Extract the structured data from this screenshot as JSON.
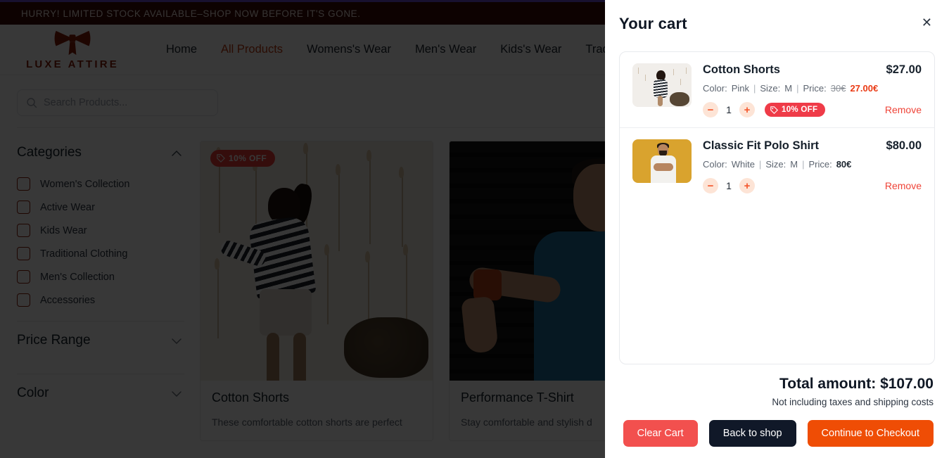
{
  "accent": {
    "promo_bg": "#3b0d05",
    "brand": "#8a1c08",
    "nav_active": "#c0390e",
    "discount_red": "#ef3b48",
    "checkout_orange": "#ef4d05",
    "dark_navy": "#101828",
    "clear_red": "#f2504e",
    "top_rule": "#6c4fd6"
  },
  "promo": {
    "text": "HURRY! LIMITED STOCK AVAILABLE–SHOP NOW BEFORE IT'S GONE."
  },
  "brand": {
    "name": "LUXE ATTIRE",
    "logo_icon": "bow-icon"
  },
  "nav": {
    "items": [
      {
        "label": "Home",
        "active": false
      },
      {
        "label": "All Products",
        "active": true
      },
      {
        "label": "Womens's Wear",
        "active": false
      },
      {
        "label": "Men's Wear",
        "active": false
      },
      {
        "label": "Kids's Wear",
        "active": false
      },
      {
        "label": "Tradi",
        "active": false
      }
    ]
  },
  "search": {
    "placeholder": "Search Products...",
    "value": "",
    "icon": "search-icon"
  },
  "sidebar": {
    "groups": [
      {
        "title": "Categories",
        "expanded": true,
        "chevron": "chevron-up-icon"
      },
      {
        "title": "Price Range",
        "expanded": false,
        "chevron": "chevron-down-icon"
      },
      {
        "title": "Color",
        "expanded": false,
        "chevron": "chevron-down-icon"
      }
    ],
    "categories": [
      {
        "label": "Women's Collection",
        "checked": false
      },
      {
        "label": "Active Wear",
        "checked": false
      },
      {
        "label": "Kids Wear",
        "checked": false
      },
      {
        "label": "Traditional Clothing",
        "checked": false
      },
      {
        "label": "Men's Collection",
        "checked": false
      },
      {
        "label": "Accessories",
        "checked": false
      }
    ]
  },
  "products": [
    {
      "name": "Cotton Shorts",
      "description": "These comfortable cotton shorts are perfect",
      "badge": "10% OFF",
      "has_badge": true,
      "image_alt": "girl-in-striped-shirt-photo"
    },
    {
      "name": "Performance T-Shirt",
      "description": "Stay comfortable and stylish d",
      "badge": "",
      "has_badge": false,
      "image_alt": "man-in-blue-tshirt-photo"
    }
  ],
  "cart": {
    "title": "Your cart",
    "close_icon": "close-icon",
    "items": [
      {
        "name": "Cotton Shorts",
        "line_total": "$27.00",
        "color_label": "Color:",
        "color": "Pink",
        "size_label": "Size:",
        "size": "M",
        "price_label": "Price:",
        "old_price": "30€",
        "new_price": "27.00€",
        "has_discount": true,
        "quantity": "1",
        "discount_badge": "10% OFF",
        "discount_icon": "tag-icon",
        "remove_label": "Remove",
        "minus_icon": "minus-icon",
        "plus_icon": "plus-icon",
        "thumb_alt": "girl-in-striped-shirt-thumb"
      },
      {
        "name": "Classic Fit Polo Shirt",
        "line_total": "$80.00",
        "color_label": "Color:",
        "color": "White",
        "size_label": "Size:",
        "size": "M",
        "price_label": "Price:",
        "old_price": "",
        "new_price": "80€",
        "has_discount": false,
        "quantity": "1",
        "discount_badge": "",
        "discount_icon": "",
        "remove_label": "Remove",
        "minus_icon": "minus-icon",
        "plus_icon": "plus-icon",
        "thumb_alt": "man-in-white-polo-thumb"
      }
    ],
    "total_label": "Total amount: $107.00",
    "total_note": "Not including taxes and shipping costs",
    "buttons": {
      "clear": "Clear Cart",
      "back": "Back to shop",
      "checkout": "Continue to Checkout"
    }
  }
}
